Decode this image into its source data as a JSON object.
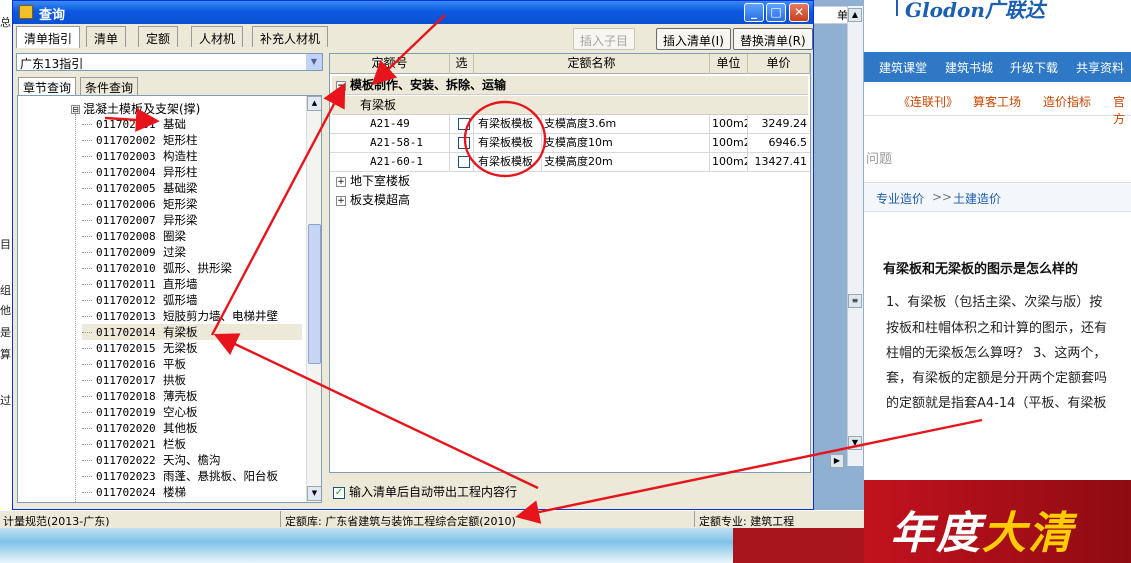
{
  "background_window": {
    "left_edge_texts": [
      "总:",
      "目",
      "组",
      "他",
      "是",
      "算",
      "过"
    ],
    "column_head": "单",
    "logo": "Glodon广联达",
    "nav_items": [
      "建筑课堂",
      "建筑书城",
      "升级下载",
      "共享资料"
    ],
    "sub_nav_items": [
      "《连联刊》",
      "算客工场",
      "造价指标",
      "官方"
    ],
    "search_hint": "问题",
    "breadcrumb": [
      "专业造价",
      "土建造价"
    ],
    "breadcrumb_sep": ">>",
    "article_title": "有梁板和无梁板的图示是怎么样的",
    "article_lines": [
      "1、有梁板（包括主梁、次梁与版）按",
      "按板和柱帽体积之和计算的图示，还有",
      "柱帽的无梁板怎么算呀？ 3、这两个，",
      "套，有梁板的定额是分开两个定额套吗",
      "的定额就是指套A4-14（平板、有梁板"
    ],
    "promo_text_a": "年度",
    "promo_text_b": "大清"
  },
  "status_bar": {
    "spec": "计量规范(2013-广东)",
    "quota_lib": "定额库: 广东省建筑与装饰工程综合定额(2010)",
    "quota_major": "定额专业: 建筑工程"
  },
  "dialog": {
    "title": "查询",
    "title_buttons": [
      "_",
      "□",
      "✕"
    ],
    "tabs": [
      "清单指引",
      "清单",
      "定额",
      "人材机",
      "补充人材机"
    ],
    "actions": {
      "insert_child": "插入子目",
      "insert_list": "插入清单(I)",
      "replace_list": "替换清单(R)"
    },
    "guide_combo": "广东13指引",
    "subtabs": [
      "章节查询",
      "条件查询"
    ],
    "tree_root": "混凝土模板及支架(撑)",
    "tree_items": [
      {
        "code": "011702001",
        "name": "基础"
      },
      {
        "code": "011702002",
        "name": "矩形柱"
      },
      {
        "code": "011702003",
        "name": "构造柱"
      },
      {
        "code": "011702004",
        "name": "异形柱"
      },
      {
        "code": "011702005",
        "name": "基础梁"
      },
      {
        "code": "011702006",
        "name": "矩形梁"
      },
      {
        "code": "011702007",
        "name": "异形梁"
      },
      {
        "code": "011702008",
        "name": "圈梁"
      },
      {
        "code": "011702009",
        "name": "过梁"
      },
      {
        "code": "011702010",
        "name": "弧形、拱形梁"
      },
      {
        "code": "011702011",
        "name": "直形墙"
      },
      {
        "code": "011702012",
        "name": "弧形墙"
      },
      {
        "code": "011702013",
        "name": "短肢剪力墙、电梯井壁"
      },
      {
        "code": "011702014",
        "name": "有梁板"
      },
      {
        "code": "011702015",
        "name": "无梁板"
      },
      {
        "code": "011702016",
        "name": "平板"
      },
      {
        "code": "011702017",
        "name": "拱板"
      },
      {
        "code": "011702018",
        "name": "薄壳板"
      },
      {
        "code": "011702019",
        "name": "空心板"
      },
      {
        "code": "011702020",
        "name": "其他板"
      },
      {
        "code": "011702021",
        "name": "栏板"
      },
      {
        "code": "011702022",
        "name": "天沟、檐沟"
      },
      {
        "code": "011702023",
        "name": "雨蓬、悬挑板、阳台板"
      },
      {
        "code": "011702024",
        "name": "楼梯"
      }
    ],
    "grid_headers": [
      "定额号",
      "选中",
      "定额名称",
      "单位",
      "单价"
    ],
    "group_main": "模板制作、安装、拆除、运输",
    "sub_group": "有梁板",
    "rows": [
      {
        "code": "A21-49",
        "name_a": "有梁板模板",
        "name_b": "支模高度3.6m",
        "unit": "100m2",
        "price": "3249.24"
      },
      {
        "code": "A21-58-1",
        "name_a": "有梁板模板",
        "name_b": "支模高度10m",
        "unit": "100m2",
        "price": "6946.5"
      },
      {
        "code": "A21-60-1",
        "name_a": "有梁板模板",
        "name_b": "支模高度20m",
        "unit": "100m2",
        "price": "13427.41"
      }
    ],
    "collapsed_groups": [
      "地下室楼板",
      "板支模超高"
    ],
    "auto_bring_check": "输入清单后自动带出工程内容行",
    "tree_pm": "⊟",
    "grid_pm_minus": "−",
    "grid_pm_plus": "+",
    "check_mark": "✓"
  },
  "colors": {
    "annotation_red": "#e8141c",
    "title_blue": "#0c5ae0",
    "nav_blue": "#2f78c6"
  }
}
